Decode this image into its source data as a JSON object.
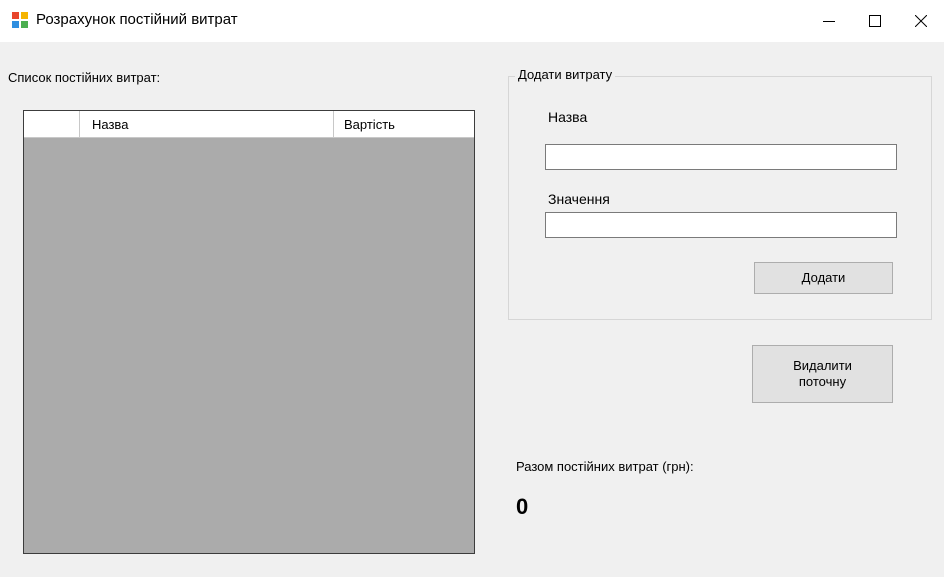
{
  "window": {
    "title": "Розрахунок постійний витрат",
    "minimize_glyph": "—",
    "maximize_glyph": "☐",
    "close_glyph": "✕"
  },
  "list": {
    "label": "Список постійних витрат:",
    "columns": [
      "Назва",
      "Вартість"
    ]
  },
  "add_group": {
    "legend": "Додати витрату",
    "name_label": "Назва",
    "name_value": "",
    "value_label": "Значення",
    "value_value": "",
    "add_button": "Додати"
  },
  "delete_button": "Видалити\nпоточну",
  "total": {
    "label": "Разом постійних витрат (грн):",
    "value": "0"
  },
  "colors": {
    "grid_background": "#ababab",
    "window_background": "#f0f0f0",
    "button_background": "#e1e1e1"
  }
}
